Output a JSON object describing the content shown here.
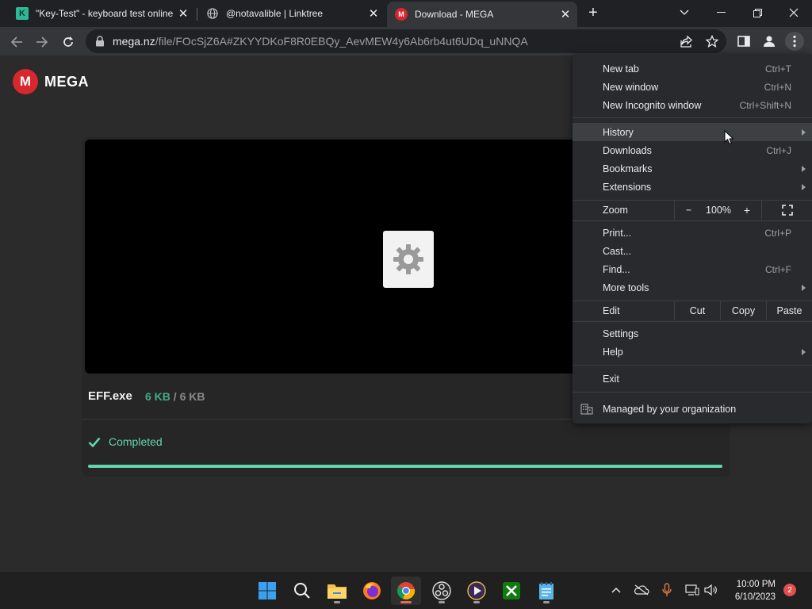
{
  "tabs": [
    {
      "title": "\"Key-Test\" - keyboard test online",
      "favicon": "K"
    },
    {
      "title": "@notavalible | Linktree",
      "favicon": "globe-icon"
    },
    {
      "title": "Download - MEGA",
      "favicon": "M"
    }
  ],
  "address_bar": {
    "host": "mega.nz",
    "path": "/file/FOcSjZ6A#ZKYYDKoF8R0EBQy_AevMEW4y6Ab6rb4ut6UDq_uNNQA"
  },
  "brand": {
    "logo_letter": "M",
    "name": "MEGA",
    "color": "#d9272e"
  },
  "file": {
    "name": "EFF.exe",
    "downloaded": "6 KB",
    "separator": "/",
    "total": "6 KB",
    "status": "Completed",
    "progress": 1.0,
    "accent": "#62d4b0"
  },
  "menu": {
    "new_tab": {
      "label": "New tab",
      "shortcut": "Ctrl+T"
    },
    "new_window": {
      "label": "New window",
      "shortcut": "Ctrl+N"
    },
    "new_incognito": {
      "label": "New Incognito window",
      "shortcut": "Ctrl+Shift+N"
    },
    "history": {
      "label": "History"
    },
    "downloads": {
      "label": "Downloads",
      "shortcut": "Ctrl+J"
    },
    "bookmarks": {
      "label": "Bookmarks"
    },
    "extensions": {
      "label": "Extensions"
    },
    "zoom": {
      "label": "Zoom",
      "minus": "−",
      "value": "100%",
      "plus": "+"
    },
    "print": {
      "label": "Print...",
      "shortcut": "Ctrl+P"
    },
    "cast": {
      "label": "Cast..."
    },
    "find": {
      "label": "Find...",
      "shortcut": "Ctrl+F"
    },
    "more_tools": {
      "label": "More tools"
    },
    "edit": {
      "label": "Edit",
      "cut": "Cut",
      "copy": "Copy",
      "paste": "Paste"
    },
    "settings": {
      "label": "Settings"
    },
    "help": {
      "label": "Help"
    },
    "exit": {
      "label": "Exit"
    },
    "managed": {
      "label": "Managed by your organization"
    }
  },
  "taskbar": {
    "apps": [
      "start-icon",
      "search-icon",
      "file-explorer-icon",
      "firefox-icon",
      "chrome-icon",
      "obs-icon",
      "media-player-icon",
      "xbox-icon",
      "notepad-icon"
    ],
    "time": "10:00 PM",
    "date": "6/10/2023",
    "notifications": "2"
  }
}
